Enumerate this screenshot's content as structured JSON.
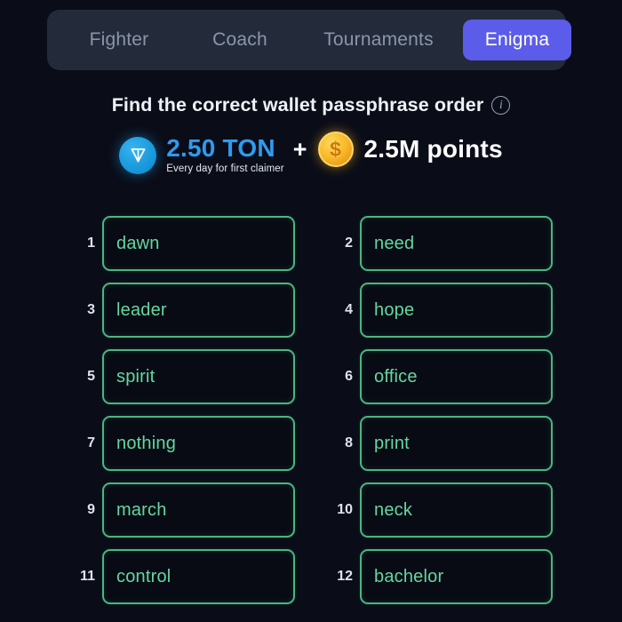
{
  "tabs": [
    {
      "label": "Fighter",
      "active": false
    },
    {
      "label": "Coach",
      "active": false
    },
    {
      "label": "Tournaments",
      "active": false
    },
    {
      "label": "Enigma",
      "active": true
    }
  ],
  "prompt": {
    "text": "Find the correct wallet passphrase order",
    "info_icon": "info-icon",
    "info_glyph": "i"
  },
  "reward": {
    "ton_icon": "ton-coin-icon",
    "ton_amount": "2.50 TON",
    "ton_subtitle": "Every day for first claimer",
    "separator": "+",
    "points_icon": "dollar-coin-icon",
    "points_glyph": "$",
    "points_amount": "2.5M points"
  },
  "grid": {
    "items": [
      {
        "number": "1",
        "word": "dawn"
      },
      {
        "number": "2",
        "word": "need"
      },
      {
        "number": "3",
        "word": "leader"
      },
      {
        "number": "4",
        "word": "hope"
      },
      {
        "number": "5",
        "word": "spirit"
      },
      {
        "number": "6",
        "word": "office"
      },
      {
        "number": "7",
        "word": "nothing"
      },
      {
        "number": "8",
        "word": "print"
      },
      {
        "number": "9",
        "word": "march"
      },
      {
        "number": "10",
        "word": "neck"
      },
      {
        "number": "11",
        "word": "control"
      },
      {
        "number": "12",
        "word": "bachelor"
      }
    ]
  },
  "colors": {
    "background": "#0a0d18",
    "tabbar_bg": "#232b3b",
    "tab_active_bg": "#5b5ce9",
    "tab_inactive_text": "#8b95a9",
    "word_border": "#4cb580",
    "word_text": "#64d7a0",
    "ton_blue": "#2e9bef",
    "coin_gold": "#f8b92a"
  }
}
